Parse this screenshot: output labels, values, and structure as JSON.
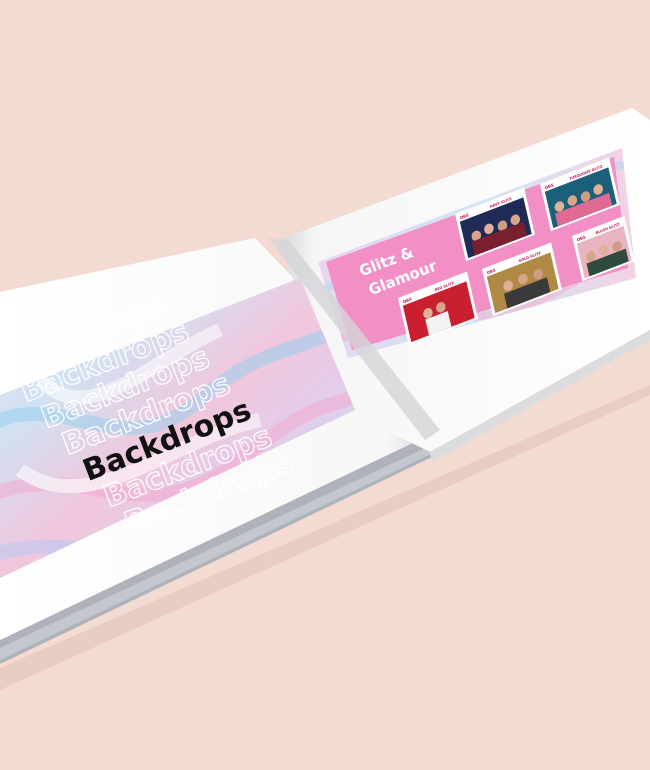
{
  "left_page": {
    "outline_word": "Backdrops",
    "title": "Backdrops"
  },
  "right_page": {
    "heading_line1": "Glitz &",
    "heading_line2": "Glamour",
    "cards": [
      {
        "brand": "DBS",
        "caption": "NAVY GLITZ"
      },
      {
        "brand": "DBS",
        "caption": "TURQUOISE GLITZ"
      },
      {
        "brand": "DBS",
        "caption": "RED GLITZ"
      },
      {
        "brand": "DBS",
        "caption": "GOLD GLITZ"
      },
      {
        "brand": "DBS",
        "caption": "BLUSH GLITZ"
      }
    ]
  },
  "colors": {
    "background": "#f3dbd2",
    "pink_panel": "#f28fc4",
    "cover_gray": "#aeb2ba"
  }
}
